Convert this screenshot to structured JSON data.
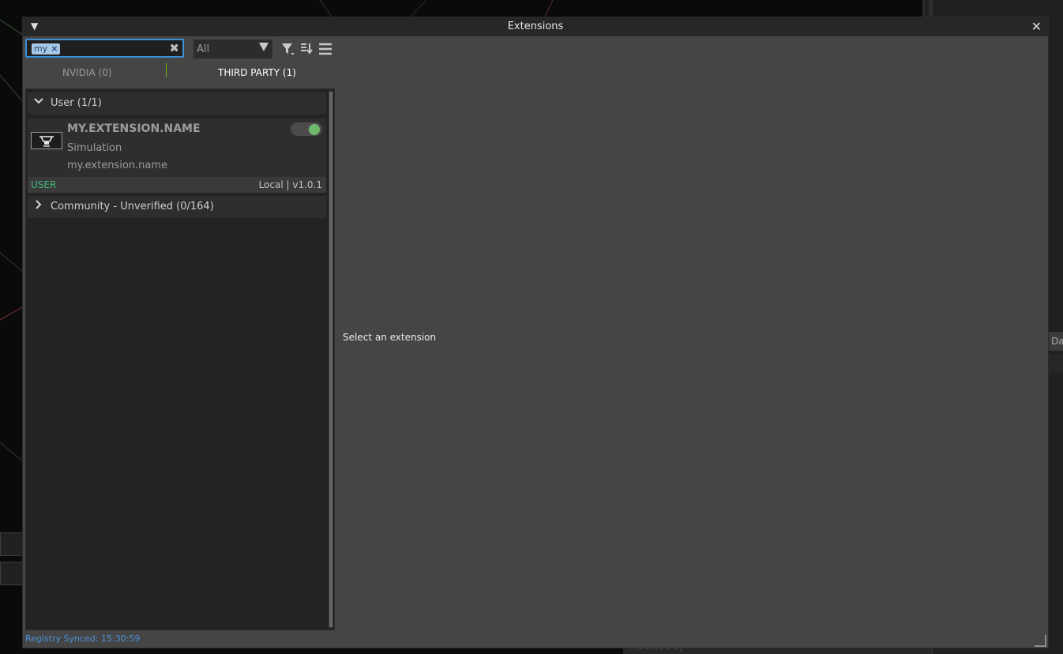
{
  "window": {
    "title": "Extensions",
    "collapse_icon": "triangle-down-icon",
    "close_icon": "close-icon"
  },
  "toolbar": {
    "search_chip": "my",
    "search_chip_remove": "×",
    "search_clear": "✖",
    "filter_value": "All",
    "icons": [
      "filter-icon",
      "sort-icon",
      "menu-icon"
    ]
  },
  "tabs": [
    {
      "label": "NVIDIA (0)",
      "active": false
    },
    {
      "label": "THIRD PARTY (1)",
      "active": true
    }
  ],
  "groups": [
    {
      "label": "User (1/1)",
      "expanded": true
    },
    {
      "label": "Community - Unverified (0/164)",
      "expanded": false
    }
  ],
  "extension": {
    "name": "MY.EXTENSION.NAME",
    "category": "Simulation",
    "id": "my.extension.name",
    "tag": "USER",
    "version": "Local | v1.0.1",
    "enabled": true
  },
  "details": {
    "empty_message": "Select an extension"
  },
  "status": {
    "text": "Registry Synced: 15:30:59"
  },
  "background": {
    "bottom_label": "Modified by",
    "right_tab": "Da"
  },
  "colors": {
    "accent_green": "#76b900",
    "toggle_on": "#6fb86b",
    "user_tag": "#3fb87d",
    "status_blue": "#4a90d9",
    "search_focus": "#3b8fd5"
  }
}
